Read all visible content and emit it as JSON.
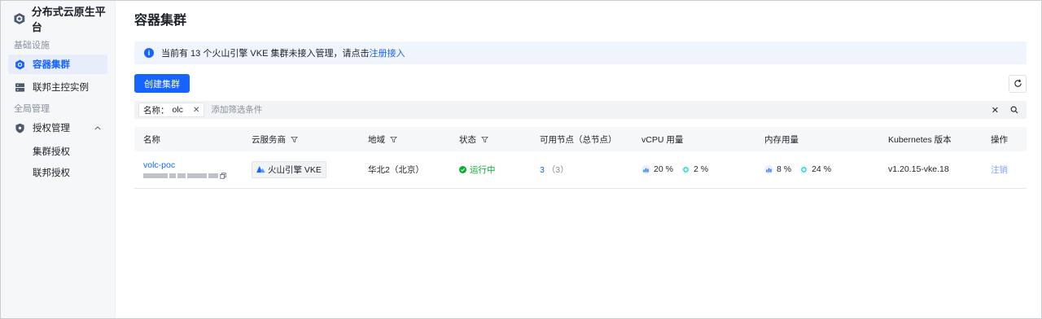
{
  "app": {
    "title": "分布式云原生平台"
  },
  "sidebar": {
    "groups": [
      {
        "title": "基础设施"
      },
      {
        "title": "全局管理"
      }
    ],
    "items": [
      {
        "label": "容器集群",
        "icon": "cluster-icon",
        "active": true
      },
      {
        "label": "联邦主控实例",
        "icon": "server-icon"
      },
      {
        "label": "授权管理",
        "icon": "shield-icon"
      }
    ],
    "sub_items": [
      {
        "label": "集群授权"
      },
      {
        "label": "联邦授权"
      }
    ]
  },
  "main": {
    "title": "容器集群",
    "notice": {
      "text": "当前有 13 个火山引擎 VKE 集群未接入管理，请点击",
      "link": "注册接入"
    },
    "create_button": "创建集群",
    "filter": {
      "tag_label": "名称：",
      "tag_value": "olc",
      "placeholder": "添加筛选条件"
    },
    "table": {
      "columns": [
        "名称",
        "云服务商",
        "地域",
        "状态",
        "可用节点（总节点）",
        "vCPU 用量",
        "内存用量",
        "Kubernetes 版本",
        "操作"
      ],
      "rows": [
        {
          "name": "volc-poc",
          "provider": "火山引擎 VKE",
          "region": "华北2（北京）",
          "status": "运行中",
          "nodes_available": "3",
          "nodes_total": "（3）",
          "vcpu_used": "20 %",
          "vcpu_requested": "2 %",
          "mem_used": "8 %",
          "mem_requested": "24 %",
          "version": "v1.20.15-vke.18",
          "action": "注销"
        }
      ]
    }
  },
  "colors": {
    "accent": "#1664ff",
    "success": "#00b42a"
  }
}
